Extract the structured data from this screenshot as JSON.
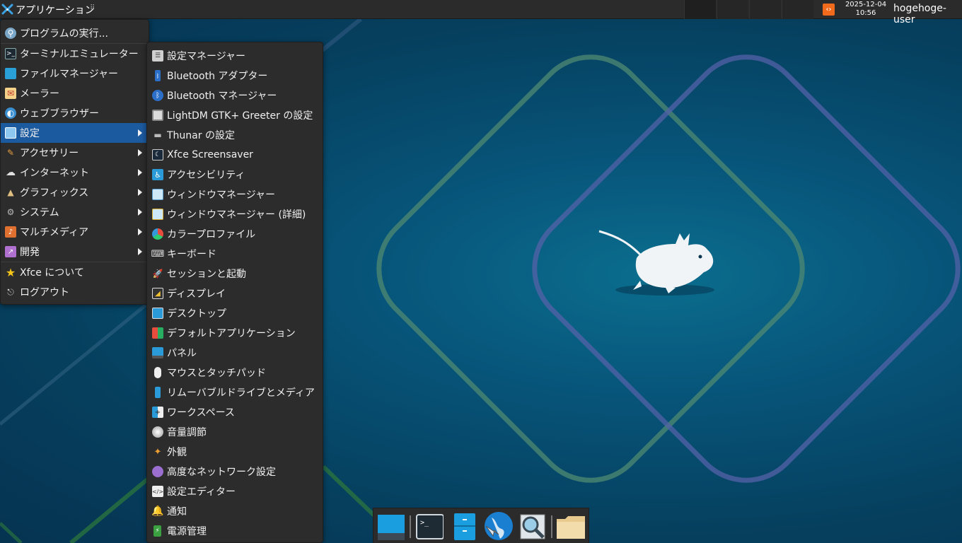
{
  "panel": {
    "app_menu_label": "アプリケーション",
    "handle_glyph": "⠿",
    "clock_date": "2025-12-04",
    "clock_time": "10:56",
    "username": "hogehoge-user",
    "notif_glyph": "‹›"
  },
  "main_menu": {
    "items": [
      {
        "label": "プログラムの実行...",
        "icon": "run-program-icon",
        "submenu": false
      },
      {
        "label": "ターミナルエミュレーター",
        "icon": "terminal-icon",
        "submenu": false
      },
      {
        "label": "ファイルマネージャー",
        "icon": "file-manager-icon",
        "submenu": false
      },
      {
        "label": "メーラー",
        "icon": "mail-icon",
        "submenu": false
      },
      {
        "label": "ウェブブラウザー",
        "icon": "web-browser-icon",
        "submenu": false
      },
      {
        "label": "設定",
        "icon": "settings-icon",
        "submenu": true,
        "active": true
      },
      {
        "label": "アクセサリー",
        "icon": "accessories-icon",
        "submenu": true
      },
      {
        "label": "インターネット",
        "icon": "internet-icon",
        "submenu": true
      },
      {
        "label": "グラフィックス",
        "icon": "graphics-icon",
        "submenu": true
      },
      {
        "label": "システム",
        "icon": "system-icon",
        "submenu": true
      },
      {
        "label": "マルチメディア",
        "icon": "multimedia-icon",
        "submenu": true
      },
      {
        "label": "開発",
        "icon": "development-icon",
        "submenu": true
      },
      {
        "label": "Xfce について",
        "icon": "star-icon",
        "submenu": false
      },
      {
        "label": "ログアウト",
        "icon": "logout-icon",
        "submenu": false
      }
    ]
  },
  "settings_menu": {
    "items": [
      {
        "label": "設定マネージャー",
        "icon": "settings-manager-icon"
      },
      {
        "label": "Bluetooth アダプター",
        "icon": "bluetooth-adapter-icon"
      },
      {
        "label": "Bluetooth マネージャー",
        "icon": "bluetooth-icon"
      },
      {
        "label": "LightDM GTK+ Greeter の設定",
        "icon": "lightdm-icon"
      },
      {
        "label": "Thunar の設定",
        "icon": "thunar-settings-icon"
      },
      {
        "label": "Xfce Screensaver",
        "icon": "screensaver-icon"
      },
      {
        "label": "アクセシビリティ",
        "icon": "accessibility-icon"
      },
      {
        "label": "ウィンドウマネージャー",
        "icon": "window-manager-icon"
      },
      {
        "label": "ウィンドウマネージャー (詳細)",
        "icon": "window-manager-tweaks-icon"
      },
      {
        "label": "カラープロファイル",
        "icon": "color-profile-icon"
      },
      {
        "label": "キーボード",
        "icon": "keyboard-icon"
      },
      {
        "label": "セッションと起動",
        "icon": "session-startup-icon"
      },
      {
        "label": "ディスプレイ",
        "icon": "display-icon"
      },
      {
        "label": "デスクトップ",
        "icon": "desktop-icon"
      },
      {
        "label": "デフォルトアプリケーション",
        "icon": "default-apps-icon"
      },
      {
        "label": "パネル",
        "icon": "panel-icon"
      },
      {
        "label": "マウスとタッチパッド",
        "icon": "mouse-icon"
      },
      {
        "label": "リムーバブルドライブとメディア",
        "icon": "removable-drive-icon"
      },
      {
        "label": "ワークスペース",
        "icon": "workspaces-icon"
      },
      {
        "label": "音量調節",
        "icon": "volume-icon"
      },
      {
        "label": "外観",
        "icon": "appearance-icon"
      },
      {
        "label": "高度なネットワーク設定",
        "icon": "network-icon"
      },
      {
        "label": "設定エディター",
        "icon": "settings-editor-icon"
      },
      {
        "label": "通知",
        "icon": "notification-bell-icon"
      },
      {
        "label": "電源管理",
        "icon": "power-manager-icon"
      }
    ]
  },
  "dock": {
    "items": [
      {
        "name": "show-desktop-icon"
      },
      {
        "name": "terminal-icon"
      },
      {
        "name": "file-manager-icon"
      },
      {
        "name": "web-browser-icon"
      },
      {
        "name": "app-finder-icon"
      },
      {
        "name": "folder-icon"
      }
    ]
  },
  "colors": {
    "panel_bg": "#2b2b2b",
    "menu_bg": "#2c2c2c",
    "highlight": "#1c5aa0"
  }
}
